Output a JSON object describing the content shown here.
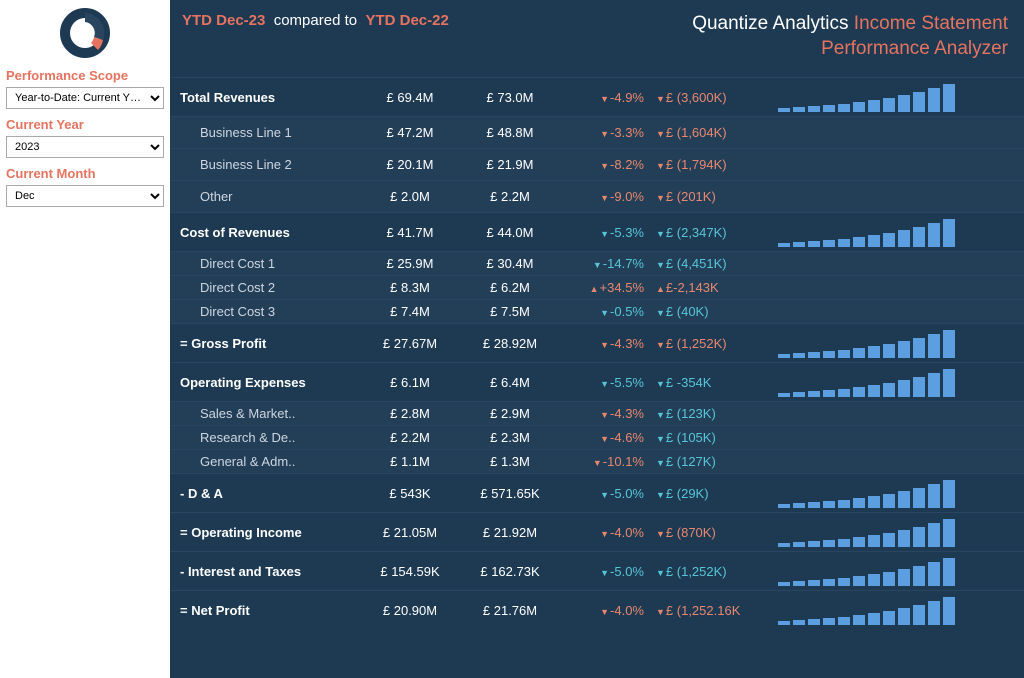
{
  "sidebar": {
    "scope_label": "Performance Scope",
    "scope_value": "Year-to-Date: Current Y…",
    "year_label": "Current Year",
    "year_value": "2023",
    "month_label": "Current Month",
    "month_value": "Dec"
  },
  "header": {
    "ytd_current": "YTD Dec-23",
    "compared_to": "compared to",
    "ytd_prior": "YTD Dec-22",
    "brand": "Quantize Analytics",
    "title1": "Income Statement",
    "title2": "Performance Analyzer"
  },
  "rows": [
    {
      "type": "major",
      "label": "Total Revenues",
      "v1": "£ 69.4M",
      "v2": "£ 73.0M",
      "pct": "-4.9%",
      "pctClass": "neg arrow-down",
      "delta": "£ (3,600K)",
      "deltaClass": "neg arrow-down",
      "spark": [
        4,
        5,
        6,
        7,
        8,
        10,
        12,
        14,
        17,
        20,
        24,
        28
      ]
    },
    {
      "type": "sub",
      "label": "Business Line 1",
      "v1": "£ 47.2M",
      "v2": "£ 48.8M",
      "pct": "-3.3%",
      "pctClass": "neg arrow-down",
      "delta": "£ (1,604K)",
      "deltaClass": "neg arrow-down"
    },
    {
      "type": "sub",
      "label": "Business Line 2",
      "v1": "£ 20.1M",
      "v2": "£ 21.9M",
      "pct": "-8.2%",
      "pctClass": "neg arrow-down",
      "delta": "£ (1,794K)",
      "deltaClass": "neg arrow-down"
    },
    {
      "type": "sub",
      "label": "Other",
      "v1": "£ 2.0M",
      "v2": "£ 2.2M",
      "pct": "-9.0%",
      "pctClass": "neg arrow-down",
      "delta": "£ (201K)",
      "deltaClass": "neg arrow-down"
    },
    {
      "type": "major",
      "label": "Cost of Revenues",
      "v1": "£ 41.7M",
      "v2": "£ 44.0M",
      "pct": "-5.3%",
      "pctClass": "pos arrow-down",
      "delta": "£ (2,347K)",
      "deltaClass": "pos arrow-down",
      "spark": [
        4,
        5,
        6,
        7,
        8,
        10,
        12,
        14,
        17,
        20,
        24,
        28
      ]
    },
    {
      "type": "sub tight",
      "label": "Direct Cost 1",
      "v1": "£ 25.9M",
      "v2": "£ 30.4M",
      "pct": "-14.7%",
      "pctClass": "pos arrow-down",
      "delta": "£ (4,451K)",
      "deltaClass": "pos arrow-down"
    },
    {
      "type": "sub tight",
      "label": "Direct Cost 2",
      "v1": "£ 8.3M",
      "v2": "£ 6.2M",
      "pct": "+34.5%",
      "pctClass": "neg arrow-up",
      "delta": "£-2,143K",
      "deltaClass": "neg arrow-up"
    },
    {
      "type": "sub tight",
      "label": "Direct Cost 3",
      "v1": "£ 7.4M",
      "v2": "£ 7.5M",
      "pct": "-0.5%",
      "pctClass": "pos arrow-down",
      "delta": "£ (40K)",
      "deltaClass": "pos arrow-down"
    },
    {
      "type": "major",
      "label": "= Gross Profit",
      "v1": "£ 27.67M",
      "v2": "£ 28.92M",
      "pct": "-4.3%",
      "pctClass": "neg arrow-down",
      "delta": "£ (1,252K)",
      "deltaClass": "neg arrow-down",
      "spark": [
        4,
        5,
        6,
        7,
        8,
        10,
        12,
        14,
        17,
        20,
        24,
        28
      ]
    },
    {
      "type": "major",
      "label": "Operating Expenses",
      "v1": "£ 6.1M",
      "v2": "£ 6.4M",
      "pct": "-5.5%",
      "pctClass": "pos arrow-down",
      "delta": "£ -354K",
      "deltaClass": "pos arrow-down",
      "spark": [
        4,
        5,
        6,
        7,
        8,
        10,
        12,
        14,
        17,
        20,
        24,
        28
      ]
    },
    {
      "type": "sub tight",
      "label": "Sales & Market..",
      "v1": "£ 2.8M",
      "v2": "£ 2.9M",
      "pct": "-4.3%",
      "pctClass": "neg arrow-down",
      "delta": "£ (123K)",
      "deltaClass": "pos arrow-down"
    },
    {
      "type": "sub tight",
      "label": "Research & De..",
      "v1": "£ 2.2M",
      "v2": "£ 2.3M",
      "pct": "-4.6%",
      "pctClass": "neg arrow-down",
      "delta": "£ (105K)",
      "deltaClass": "pos arrow-down"
    },
    {
      "type": "sub tight",
      "label": "General & Adm..",
      "v1": "£ 1.1M",
      "v2": "£ 1.3M",
      "pct": "-10.1%",
      "pctClass": "neg arrow-down",
      "delta": "£ (127K)",
      "deltaClass": "pos arrow-down"
    },
    {
      "type": "major",
      "label": "- D & A",
      "v1": "£ 543K",
      "v2": "£ 571.65K",
      "pct": "-5.0%",
      "pctClass": "pos arrow-down",
      "delta": "£ (29K)",
      "deltaClass": "pos arrow-down",
      "spark": [
        4,
        5,
        6,
        7,
        8,
        10,
        12,
        14,
        17,
        20,
        24,
        28
      ]
    },
    {
      "type": "major",
      "label": "= Operating Income",
      "v1": "£ 21.05M",
      "v2": "£ 21.92M",
      "pct": "-4.0%",
      "pctClass": "neg arrow-down",
      "delta": "£ (870K)",
      "deltaClass": "neg arrow-down",
      "spark": [
        4,
        5,
        6,
        7,
        8,
        10,
        12,
        14,
        17,
        20,
        24,
        28
      ]
    },
    {
      "type": "major",
      "label": "- Interest and Taxes",
      "v1": "£ 154.59K",
      "v2": "£ 162.73K",
      "pct": "-5.0%",
      "pctClass": "pos arrow-down",
      "delta": "£ (1,252K)",
      "deltaClass": "pos arrow-down",
      "spark": [
        4,
        5,
        6,
        7,
        8,
        10,
        12,
        14,
        17,
        20,
        24,
        28
      ]
    },
    {
      "type": "major",
      "label": "= Net Profit",
      "v1": "£ 20.90M",
      "v2": "£ 21.76M",
      "pct": "-4.0%",
      "pctClass": "neg arrow-down",
      "delta": "£ (1,252.16K",
      "deltaClass": "neg arrow-down",
      "spark": [
        4,
        5,
        6,
        7,
        8,
        10,
        12,
        14,
        17,
        20,
        24,
        28
      ]
    }
  ],
  "chart_data": {
    "type": "table",
    "title": "Income Statement Performance Analyzer",
    "period_current": "YTD Dec-23",
    "period_prior": "YTD Dec-22",
    "currency": "GBP",
    "line_items": [
      {
        "name": "Total Revenues",
        "current": 69400000,
        "prior": 73000000,
        "pct_change": -4.9,
        "abs_change": -3600000
      },
      {
        "name": "Business Line 1",
        "current": 47200000,
        "prior": 48800000,
        "pct_change": -3.3,
        "abs_change": -1604000,
        "parent": "Total Revenues"
      },
      {
        "name": "Business Line 2",
        "current": 20100000,
        "prior": 21900000,
        "pct_change": -8.2,
        "abs_change": -1794000,
        "parent": "Total Revenues"
      },
      {
        "name": "Other",
        "current": 2000000,
        "prior": 2200000,
        "pct_change": -9.0,
        "abs_change": -201000,
        "parent": "Total Revenues"
      },
      {
        "name": "Cost of Revenues",
        "current": 41700000,
        "prior": 44000000,
        "pct_change": -5.3,
        "abs_change": -2347000
      },
      {
        "name": "Direct Cost 1",
        "current": 25900000,
        "prior": 30400000,
        "pct_change": -14.7,
        "abs_change": -4451000,
        "parent": "Cost of Revenues"
      },
      {
        "name": "Direct Cost 2",
        "current": 8300000,
        "prior": 6200000,
        "pct_change": 34.5,
        "abs_change": 2143000,
        "parent": "Cost of Revenues"
      },
      {
        "name": "Direct Cost 3",
        "current": 7400000,
        "prior": 7500000,
        "pct_change": -0.5,
        "abs_change": -40000,
        "parent": "Cost of Revenues"
      },
      {
        "name": "Gross Profit",
        "current": 27670000,
        "prior": 28920000,
        "pct_change": -4.3,
        "abs_change": -1252000
      },
      {
        "name": "Operating Expenses",
        "current": 6100000,
        "prior": 6400000,
        "pct_change": -5.5,
        "abs_change": -354000
      },
      {
        "name": "Sales & Marketing",
        "current": 2800000,
        "prior": 2900000,
        "pct_change": -4.3,
        "abs_change": -123000,
        "parent": "Operating Expenses"
      },
      {
        "name": "Research & Development",
        "current": 2200000,
        "prior": 2300000,
        "pct_change": -4.6,
        "abs_change": -105000,
        "parent": "Operating Expenses"
      },
      {
        "name": "General & Admin",
        "current": 1100000,
        "prior": 1300000,
        "pct_change": -10.1,
        "abs_change": -127000,
        "parent": "Operating Expenses"
      },
      {
        "name": "D & A",
        "current": 543000,
        "prior": 571650,
        "pct_change": -5.0,
        "abs_change": -29000
      },
      {
        "name": "Operating Income",
        "current": 21050000,
        "prior": 21920000,
        "pct_change": -4.0,
        "abs_change": -870000
      },
      {
        "name": "Interest and Taxes",
        "current": 154590,
        "prior": 162730,
        "pct_change": -5.0,
        "abs_change": -1252000
      },
      {
        "name": "Net Profit",
        "current": 20900000,
        "prior": 21760000,
        "pct_change": -4.0,
        "abs_change": -1252160
      }
    ]
  }
}
